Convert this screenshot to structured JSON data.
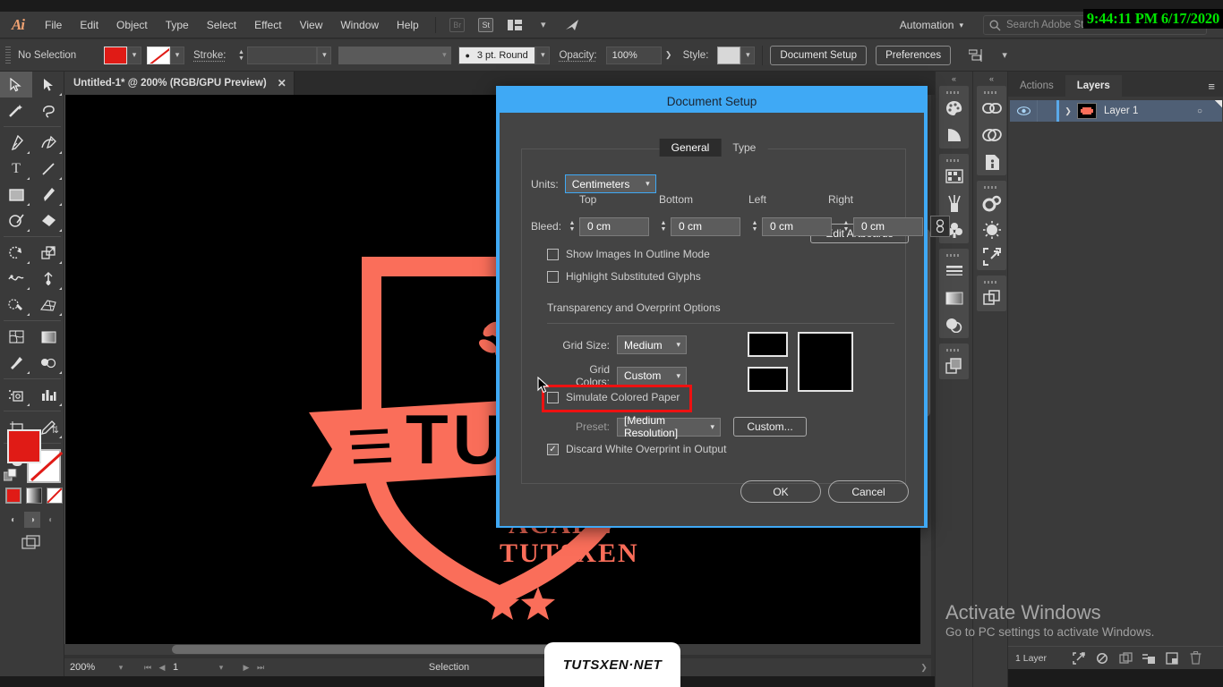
{
  "app": {
    "name": "Adobe Illustrator",
    "logo_text": "Ai"
  },
  "menubar": {
    "items": [
      "File",
      "Edit",
      "Object",
      "Type",
      "Select",
      "Effect",
      "View",
      "Window",
      "Help"
    ],
    "bridge_badge": "Br",
    "stock_badge": "St",
    "automation_label": "Automation"
  },
  "search": {
    "placeholder": "Search Adobe Stock"
  },
  "clock": {
    "text": "9:44:11 PM 6/17/2020"
  },
  "controlbar": {
    "selection_status": "No Selection",
    "stroke_label": "Stroke:",
    "stroke_weight": "3 pt. Round",
    "opacity_label": "Opacity:",
    "opacity_value": "100%",
    "style_label": "Style:",
    "document_setup_button": "Document Setup",
    "preferences_button": "Preferences"
  },
  "document_tab": {
    "title": "Untitled-1* @ 200% (RGB/GPU Preview)",
    "close": "✕"
  },
  "toolbar": {
    "tools": [
      {
        "name": "selection-tool",
        "glyph": "➤",
        "active": true
      },
      {
        "name": "direct-selection-tool",
        "glyph": "➤",
        "active": false
      },
      {
        "name": "magic-wand-tool",
        "glyph": "✨",
        "active": false
      },
      {
        "name": "lasso-tool",
        "glyph": "⥁",
        "active": false
      },
      {
        "name": "pen-tool",
        "glyph": "✒",
        "active": false
      },
      {
        "name": "curvature-tool",
        "glyph": "✒",
        "active": false
      },
      {
        "name": "type-tool",
        "glyph": "T",
        "active": false
      },
      {
        "name": "line-segment-tool",
        "glyph": "╱",
        "active": false
      },
      {
        "name": "rectangle-tool",
        "glyph": "▢",
        "active": false
      },
      {
        "name": "paintbrush-tool",
        "glyph": "✎",
        "active": false
      },
      {
        "name": "shaper-tool",
        "glyph": "◯",
        "active": false
      },
      {
        "name": "eraser-tool",
        "glyph": "◆",
        "active": false
      },
      {
        "name": "rotate-tool",
        "glyph": "↺",
        "active": false
      },
      {
        "name": "scale-tool",
        "glyph": "⤡",
        "active": false
      },
      {
        "name": "width-tool",
        "glyph": "∿",
        "active": false
      },
      {
        "name": "free-transform-tool",
        "glyph": "✦",
        "active": false
      },
      {
        "name": "shape-builder-tool",
        "glyph": "◔",
        "active": false
      },
      {
        "name": "perspective-grid-tool",
        "glyph": "◫",
        "active": false
      },
      {
        "name": "mesh-tool",
        "glyph": "▦",
        "active": false
      },
      {
        "name": "gradient-tool",
        "glyph": "▤",
        "active": false
      },
      {
        "name": "eyedropper-tool",
        "glyph": "✎",
        "active": false
      },
      {
        "name": "blend-tool",
        "glyph": "◑",
        "active": false
      },
      {
        "name": "symbol-sprayer-tool",
        "glyph": "⚙",
        "active": false
      },
      {
        "name": "column-graph-tool",
        "glyph": "█",
        "active": false
      },
      {
        "name": "artboard-tool",
        "glyph": "⬚",
        "active": false
      },
      {
        "name": "slice-tool",
        "glyph": "✐",
        "active": false
      },
      {
        "name": "hand-tool",
        "glyph": "✋",
        "active": false
      },
      {
        "name": "zoom-tool",
        "glyph": "⚲",
        "active": false
      }
    ],
    "fill_color": "#e01b16",
    "stroke_color": "#ffffff"
  },
  "canvas": {
    "background_color": "#000000",
    "artwork_color": "#fa6e5a",
    "artwork_text_line1": "TUTS",
    "artwork_text_line2": "ACADE",
    "artwork_text_line3": "TUTSXEN"
  },
  "watermark": {
    "text": "TUTSXEN·NET"
  },
  "statusbar": {
    "zoom_level": "200%",
    "page_number": "1",
    "tool_status": "Selection"
  },
  "rails": {
    "rail1": [
      {
        "name": "color-panel-icon",
        "glyph": "◕"
      },
      {
        "name": "color-guide-icon",
        "glyph": "◠"
      },
      {
        "name": "swatches-panel-icon",
        "glyph": "▦"
      },
      {
        "name": "brushes-panel-icon",
        "glyph": "❀"
      },
      {
        "name": "symbols-panel-icon",
        "glyph": "♣"
      },
      {
        "name": "stroke-panel-icon",
        "glyph": "☰"
      },
      {
        "name": "gradient-panel-icon",
        "glyph": "▤"
      },
      {
        "name": "transparency-panel-icon",
        "glyph": "◑"
      },
      {
        "name": "appearance-panel-icon",
        "glyph": "❐"
      }
    ],
    "rail2": [
      {
        "name": "links-panel-icon",
        "glyph": "⚭"
      },
      {
        "name": "creative-cloud-libraries-icon",
        "glyph": "∞"
      },
      {
        "name": "document-info-icon",
        "glyph": "ⓘ"
      },
      {
        "name": "graphic-styles-icon",
        "glyph": "⚙"
      },
      {
        "name": "effects-panel-icon",
        "glyph": "☀"
      },
      {
        "name": "asset-export-icon",
        "glyph": "↗"
      },
      {
        "name": "artboards-panel-icon",
        "glyph": "❐"
      }
    ]
  },
  "layers_panel": {
    "tabs": [
      {
        "label": "Actions",
        "active": false
      },
      {
        "label": "Layers",
        "active": true
      }
    ],
    "menu_icon": "≡",
    "rows": [
      {
        "name": "Layer 1",
        "visible": true,
        "expand_icon": "❯",
        "target_icon": "○"
      }
    ],
    "footer_count": "1 Layer",
    "footer_icons": [
      {
        "name": "locate-object-icon",
        "glyph": "↗"
      },
      {
        "name": "make-clipping-mask-icon",
        "glyph": "⬭"
      },
      {
        "name": "make-sublayer-icon",
        "glyph": "❐"
      },
      {
        "name": "create-new-sublayer-icon",
        "glyph": "⧉"
      },
      {
        "name": "create-new-layer-icon",
        "glyph": "◧"
      },
      {
        "name": "delete-selection-icon",
        "glyph": "Ὕ1"
      }
    ]
  },
  "dialog": {
    "title": "Document Setup",
    "tabs": [
      {
        "label": "General",
        "active": true
      },
      {
        "label": "Type",
        "active": false
      }
    ],
    "units_label": "Units:",
    "units_value": "Centimeters",
    "edit_artboards_button": "Edit Artboards",
    "bleed_label": "Bleed:",
    "bleed_headers": [
      "Top",
      "Bottom",
      "Left",
      "Right"
    ],
    "bleed_values": [
      "0 cm",
      "0 cm",
      "0 cm",
      "0 cm"
    ],
    "link_icon": "⚭",
    "checkbox_show_images": {
      "label": "Show Images In Outline Mode",
      "checked": false
    },
    "checkbox_highlight_glyphs": {
      "label": "Highlight Substituted Glyphs",
      "checked": false
    },
    "section_label": "Transparency and Overprint Options",
    "grid_size_label": "Grid Size:",
    "grid_size_value": "Medium",
    "grid_colors_label": "Grid Colors:",
    "grid_colors_value": "Custom",
    "checkbox_simulate_paper": {
      "label": "Simulate Colored Paper",
      "checked": false
    },
    "preset_label": "Preset:",
    "preset_value": "[Medium Resolution]",
    "custom_button": "Custom...",
    "checkbox_discard_white": {
      "label": "Discard White Overprint in Output",
      "checked": true
    },
    "ok_button": "OK",
    "cancel_button": "Cancel",
    "highlight_color": "#ee1111",
    "accent_color": "#3fa9f5",
    "grid_swatch_color": "#000000"
  },
  "os_watermark": {
    "line1": "Activate Windows",
    "line2": "Go to PC settings to activate Windows."
  }
}
